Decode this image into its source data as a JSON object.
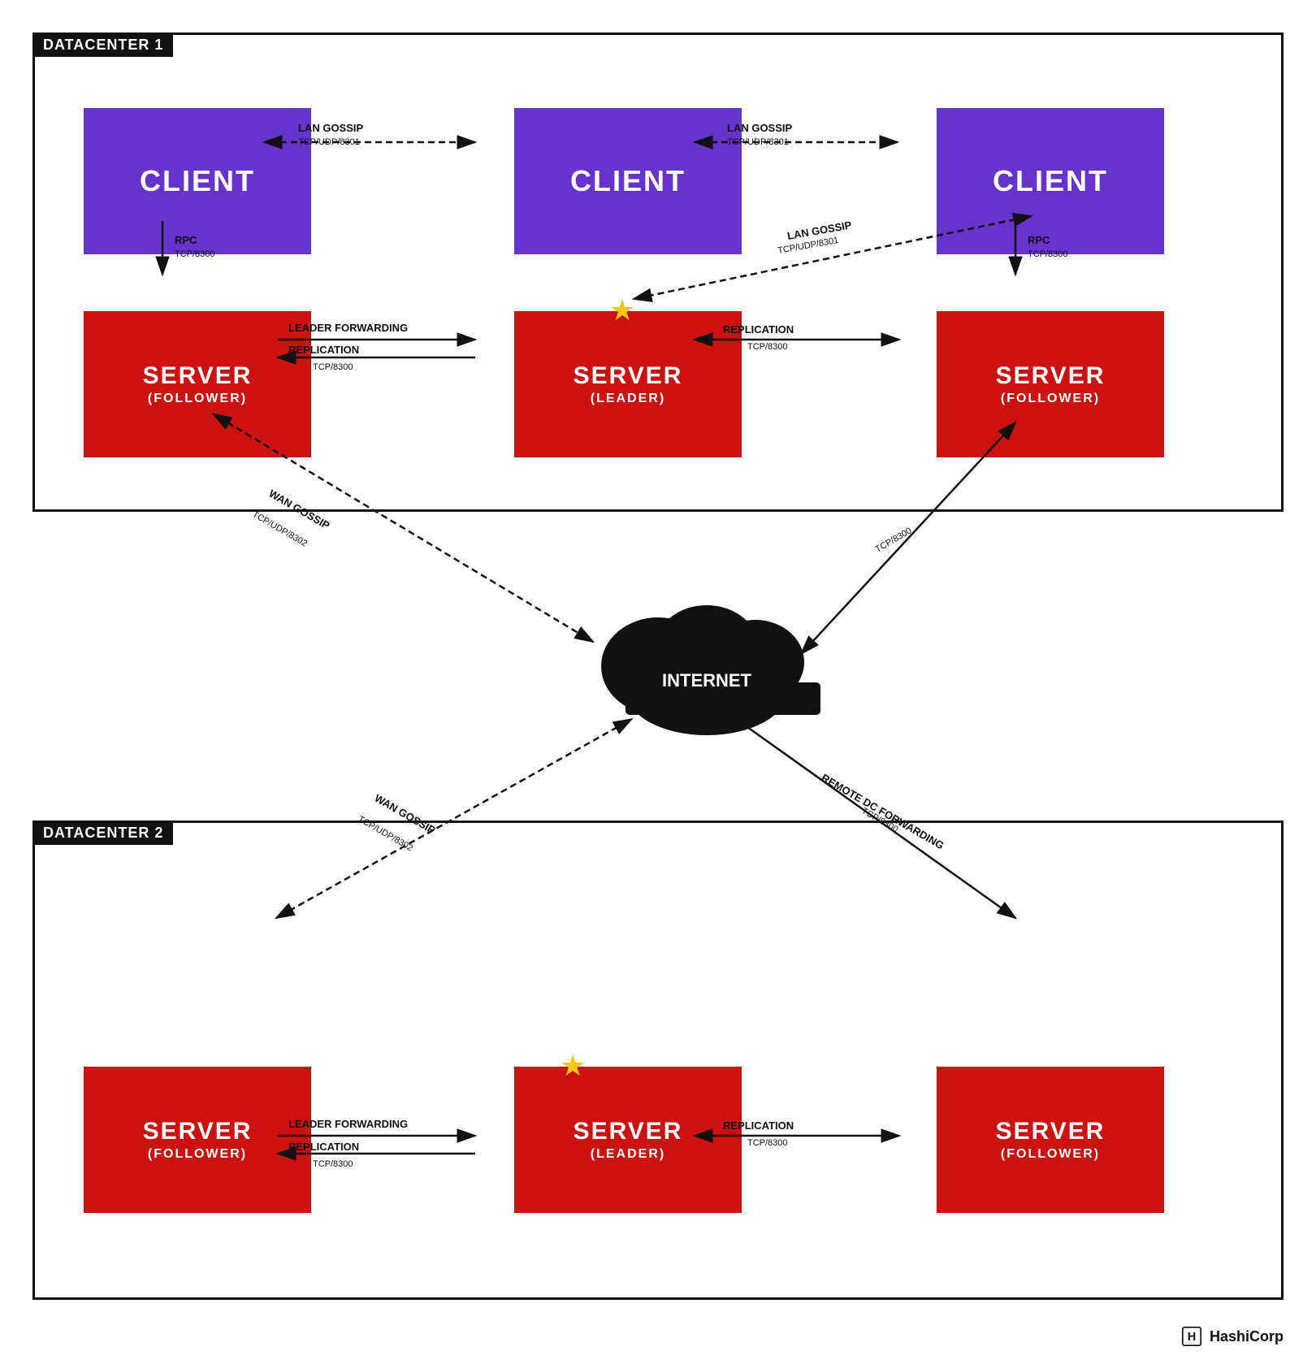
{
  "dc1": {
    "label": "DATACENTER 1",
    "clients": [
      {
        "label": "CLIENT"
      },
      {
        "label": "CLIENT"
      },
      {
        "label": "CLIENT"
      }
    ],
    "servers": [
      {
        "title": "SERVER",
        "subtitle": "(FOLLOWER)"
      },
      {
        "title": "SERVER",
        "subtitle": "(LEADER)"
      },
      {
        "title": "SERVER",
        "subtitle": "(FOLLOWER)"
      }
    ]
  },
  "dc2": {
    "label": "DATACENTER 2",
    "servers": [
      {
        "title": "SERVER",
        "subtitle": "(FOLLOWER)"
      },
      {
        "title": "SERVER",
        "subtitle": "(LEADER)"
      },
      {
        "title": "SERVER",
        "subtitle": "(FOLLOWER)"
      }
    ]
  },
  "internet": {
    "label": "INTERNET"
  },
  "connections": {
    "lan_gossip": "LAN GOSSIP",
    "lan_gossip_port": "TCP/UDP/8301",
    "rpc": "RPC",
    "rpc_port": "TCP/8300",
    "leader_forwarding": "LEADER FORWARDING",
    "replication": "REPLICATION",
    "tcp8300": "TCP/8300",
    "wan_gossip": "WAN GOSSIP",
    "wan_gossip_port": "TCP/UDP/8302",
    "remote_dc": "REMOTE DC FORWARDING",
    "remote_dc_port": "TCP/8300"
  },
  "hashicorp": {
    "label": "HashiCorp"
  }
}
